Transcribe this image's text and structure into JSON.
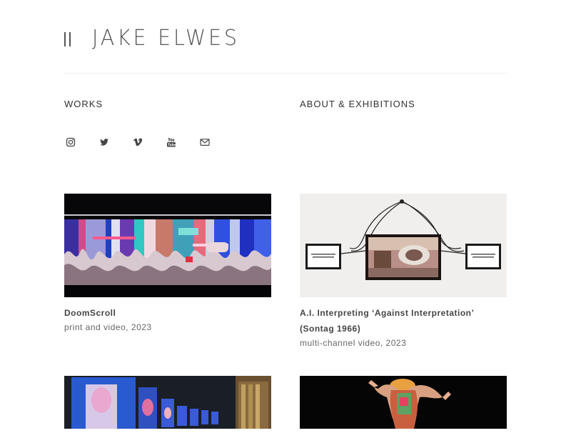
{
  "site": {
    "logo_text": "JAKE ELWES"
  },
  "nav": {
    "works": "WORKS",
    "about": "ABOUT & EXHIBITIONS"
  },
  "social": [
    {
      "icon": "instagram-icon"
    },
    {
      "icon": "twitter-icon"
    },
    {
      "icon": "vimeo-icon"
    },
    {
      "icon": "youtube-icon"
    },
    {
      "icon": "mail-icon"
    }
  ],
  "works": [
    {
      "title": "DoomScroll",
      "meta": "print and video, 2023"
    },
    {
      "title": "A.I. Interpreting ‘Against Interpretation’ (Sontag 1966)",
      "meta": "multi-channel video, 2023"
    },
    {
      "title": "",
      "meta": ""
    },
    {
      "title": "",
      "meta": ""
    }
  ],
  "colors": {
    "text": "#333333",
    "meta": "#666666",
    "logo": "#555555",
    "divider": "#eeeeee"
  }
}
